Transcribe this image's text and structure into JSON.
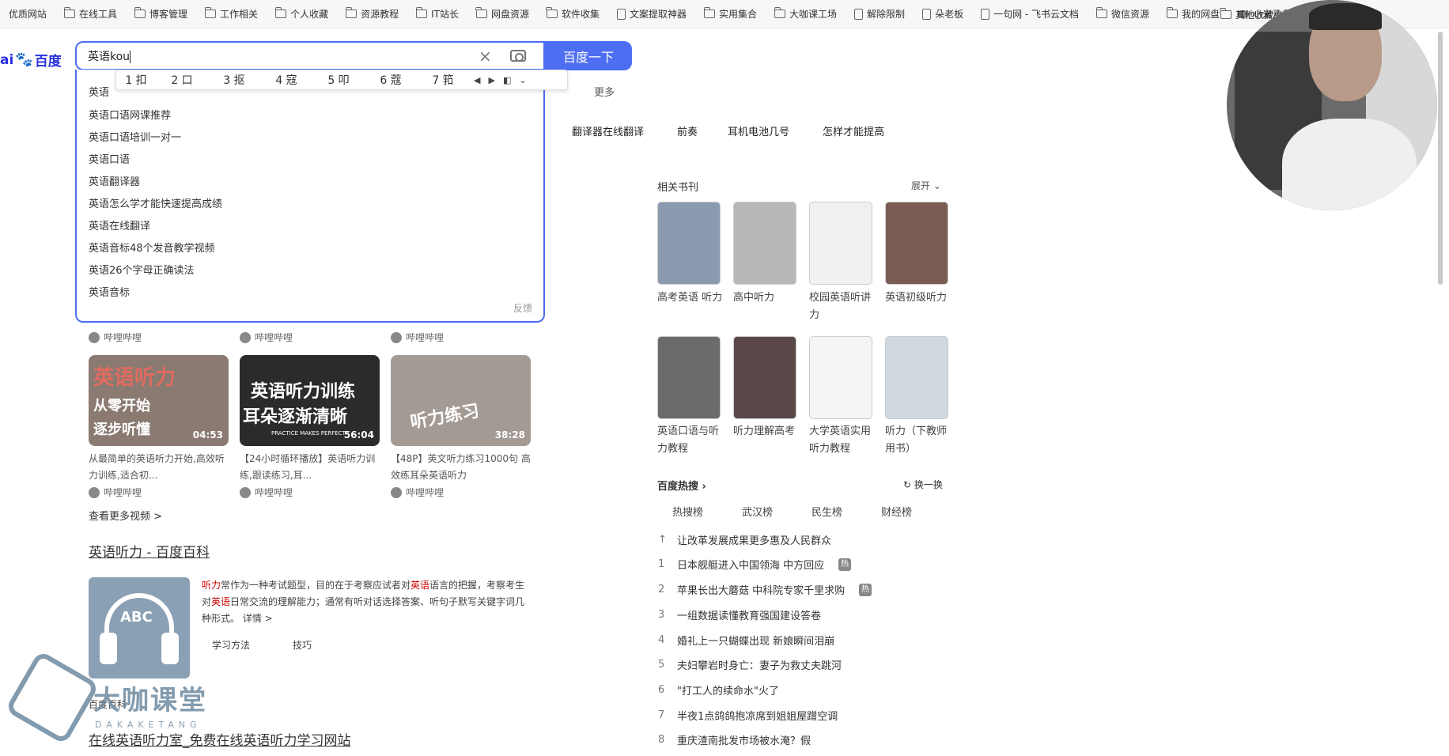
{
  "bookmarks": [
    "优质网站",
    "在线工具",
    "博客管理",
    "工作相关",
    "个人收藏",
    "资源教程",
    "IT站长",
    "网盘资源",
    "软件收集",
    "文案提取神器",
    "实用集合",
    "大咖课工场",
    "解除限制",
    "朵老板",
    "一句网 - 飞书云文档",
    "微信资源",
    "我的网盘",
    "小米云盘"
  ],
  "bookmarks_more": "其他收藏夹",
  "logo": {
    "bai": "ai",
    "paw": "🐾",
    "text": "百度"
  },
  "search": {
    "value": "英语kou",
    "button": "百度一下"
  },
  "ime": {
    "candidates": [
      "1 扣",
      "2 口",
      "3 抠",
      "4 寇",
      "5 叩",
      "6 蔻",
      "7 筘"
    ]
  },
  "suggestions": [
    "英语口语网课推荐",
    "英语口语培训一对一",
    "英语口语",
    "英语翻译器",
    "英语怎么学才能快速提高成绩",
    "英语在线翻译",
    "英语音标48个发音教学视频",
    "英语26个字母正确读法",
    "英语音标"
  ],
  "dropdown_first_partial": "英语",
  "feedback": "反馈",
  "nav_more": "更多",
  "related_searches": [
    "翻译器在线翻译",
    "前奏",
    "耳机电池几号",
    "怎样才能提高"
  ],
  "videos": [
    {
      "thumb_title": "英语听力",
      "thumb_sub1": "从零开始",
      "thumb_sub2": "逐步听懂",
      "duration": "04:53",
      "caption": "从最简单的英语听力开始,高效听力训练,适合初...",
      "source": "哔哩哔哩"
    },
    {
      "thumb_title": "英语听力训练",
      "thumb_sub1": "耳朵逐渐清晰",
      "thumb_sub2": "PRACTICE MAKES PERFECT",
      "duration": "56:04",
      "caption": "【24小时循环播放】英语听力训练,跟读练习,耳...",
      "source": "哔哩哔哩"
    },
    {
      "thumb_title": "听力练习",
      "thumb_sub1": "",
      "thumb_sub2": "",
      "duration": "38:28",
      "caption": "【48P】英文听力练习1000句 高效练耳朵英语听力",
      "source": "哔哩哔哩"
    }
  ],
  "top_sources": [
    "哔哩哔哩",
    "哔哩哔哩",
    "哔哩哔哩"
  ],
  "see_more_videos": "查看更多视频 >",
  "wiki": {
    "title": "英语听力 - 百度百科",
    "image_label": "ABC",
    "text_a": "听力",
    "text_b": "常作为一种考试题型，目的在于考察应试者对",
    "text_c": "英语",
    "text_d": "语言的把握，考察考生对",
    "text_e": "英语",
    "text_f": "日常交流的理解能力；通常有听对话选择答案、听句子默写关键字词几种形式。",
    "detail": "详情 >",
    "tabs": [
      "学习方法",
      "技巧"
    ]
  },
  "watermark": {
    "name": "大咖课堂",
    "sub": "DAKAKETANG"
  },
  "small_label": "百度百科",
  "bottom_link": "在线英语听力室_免费在线英语听力学习网站",
  "books": {
    "title": "相关书刊",
    "expand": "展开",
    "items": [
      {
        "title": "高考英语 听力",
        "color": "#8a9bb0"
      },
      {
        "title": "高中听力",
        "color": "#b7b7b7"
      },
      {
        "title": "校园英语听讲力",
        "color": "#f0f0f0"
      },
      {
        "title": "英语初级听力",
        "color": "#7a5c54"
      },
      {
        "title": "英语口语与听力教程",
        "color": "#6b6b6b"
      },
      {
        "title": "听力理解高考",
        "color": "#5a4848"
      },
      {
        "title": "大学英语实用听力教程",
        "color": "#f5f5f5"
      },
      {
        "title": "听力（下教师用书）",
        "color": "#d0d8e0"
      }
    ]
  },
  "hot": {
    "title": "百度热搜",
    "refresh": "换一换",
    "tabs": [
      "热搜榜",
      "武汉榜",
      "民生榜",
      "财经榜"
    ],
    "items": [
      {
        "num": "↑",
        "text": "让改革发展成果更多惠及人民群众",
        "badge": ""
      },
      {
        "num": "1",
        "text": "日本舰艇进入中国领海 中方回应",
        "badge": "热"
      },
      {
        "num": "2",
        "text": "苹果长出大蘑菇 中科院专家千里求购",
        "badge": "热"
      },
      {
        "num": "3",
        "text": "一组数据读懂教育强国建设答卷",
        "badge": ""
      },
      {
        "num": "4",
        "text": "婚礼上一只蝴蝶出现 新娘瞬间泪崩",
        "badge": ""
      },
      {
        "num": "5",
        "text": "夫妇攀岩时身亡：妻子为救丈夫跳河",
        "badge": ""
      },
      {
        "num": "6",
        "text": "\"打工人的续命水\"火了",
        "badge": ""
      },
      {
        "num": "7",
        "text": "半夜1点鸽鸽抱凉席到姐姐屋蹭空调",
        "badge": ""
      },
      {
        "num": "8",
        "text": "重庆渣南批发市场被水淹？假",
        "badge": ""
      }
    ]
  }
}
